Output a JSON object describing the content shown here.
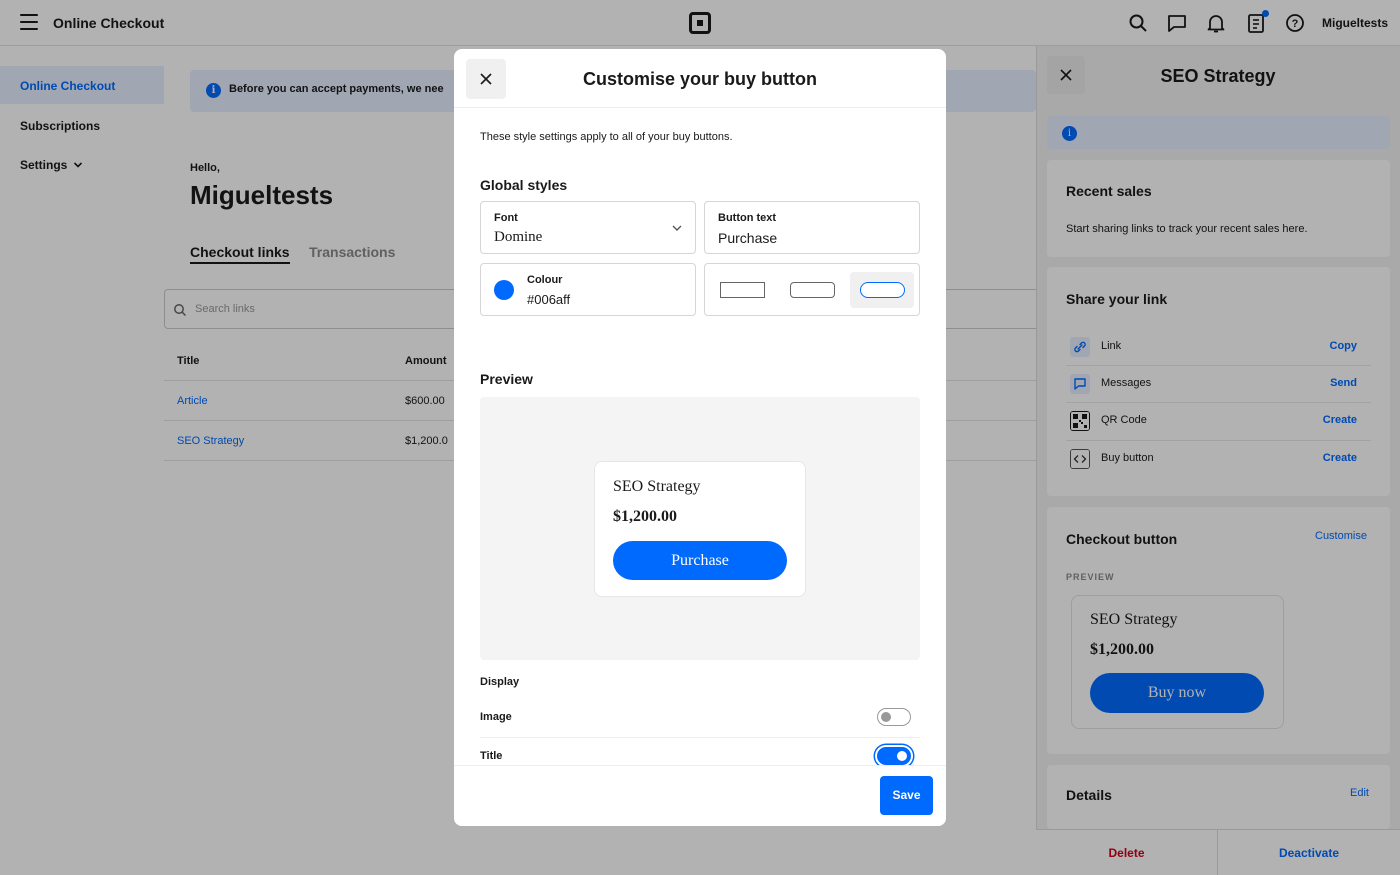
{
  "topbar": {
    "app_title": "Online Checkout",
    "username": "Migueltests",
    "icons": [
      "hamburger-icon",
      "square-logo",
      "search-icon",
      "chat-icon",
      "bell-icon",
      "clipboard-icon",
      "help-icon"
    ]
  },
  "sidebar": {
    "items": [
      {
        "label": "Online Checkout",
        "active": true
      },
      {
        "label": "Subscriptions",
        "active": false
      },
      {
        "label": "Settings",
        "active": false
      }
    ]
  },
  "main": {
    "banner_text": "Before you can accept payments, we nee",
    "hello": "Hello,",
    "username": "Migueltests",
    "tabs": [
      {
        "label": "Checkout links",
        "active": true
      },
      {
        "label": "Transactions",
        "active": false
      }
    ],
    "search_placeholder": "Search links",
    "table": {
      "headers": [
        "Title",
        "Amount"
      ],
      "rows": [
        {
          "title": "Article",
          "amount": "$600.00"
        },
        {
          "title": "SEO Strategy",
          "amount": "$1,200.0"
        }
      ]
    }
  },
  "right_panel": {
    "title": "SEO Strategy",
    "recent_sales": {
      "title": "Recent sales",
      "text": "Start sharing links to track your recent sales here."
    },
    "share": {
      "title": "Share your link",
      "rows": [
        {
          "label": "Link",
          "action": "Copy",
          "icon": "link-icon"
        },
        {
          "label": "Messages",
          "action": "Send",
          "icon": "message-icon"
        },
        {
          "label": "QR Code",
          "action": "Create",
          "icon": "qr-code-icon"
        },
        {
          "label": "Buy button",
          "action": "Create",
          "icon": "code-icon"
        }
      ]
    },
    "checkout_button": {
      "title": "Checkout button",
      "customise": "Customise",
      "preview_caption": "PREVIEW",
      "product": "SEO Strategy",
      "price": "$1,200.00",
      "button_label": "Buy now"
    },
    "details": {
      "title": "Details",
      "edit": "Edit"
    },
    "footer": {
      "delete": "Delete",
      "deactivate": "Deactivate"
    },
    "colors": {
      "delete": "#d0021b",
      "accent": "#006aff"
    }
  },
  "modal": {
    "title": "Customise your buy button",
    "description": "These style settings apply to all of your buy buttons.",
    "global_styles_title": "Global styles",
    "font": {
      "label": "Font",
      "value": "Domine"
    },
    "button_text": {
      "label": "Button text",
      "value": "Purchase"
    },
    "colour": {
      "label": "Colour",
      "value": "#006aff"
    },
    "shape_options": [
      "square",
      "rounded",
      "pill"
    ],
    "shape_selected": "pill",
    "preview_title": "Preview",
    "preview": {
      "product": "SEO Strategy",
      "price": "$1,200.00",
      "button_label": "Purchase"
    },
    "display_title": "Display",
    "display_options": [
      {
        "label": "Image",
        "on": false
      },
      {
        "label": "Title",
        "on": true
      }
    ],
    "save_label": "Save"
  }
}
